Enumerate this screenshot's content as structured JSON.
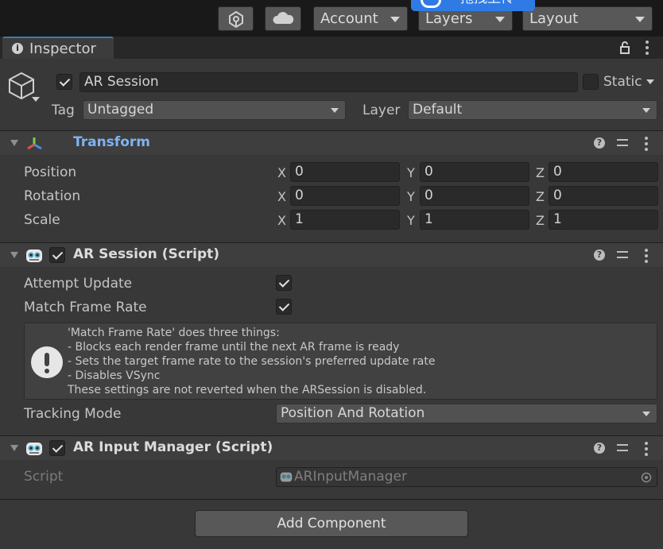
{
  "toolbar": {
    "account_label": "Account",
    "layers_label": "Layers",
    "layout_label": "Layout",
    "overlay_text": "拖拽上传"
  },
  "tab": {
    "label": "Inspector"
  },
  "gameobject": {
    "active": true,
    "name": "AR Session",
    "static_label": "Static",
    "tag_label": "Tag",
    "tag_value": "Untagged",
    "layer_label": "Layer",
    "layer_value": "Default"
  },
  "transform": {
    "title": "Transform",
    "rows": [
      {
        "label": "Position",
        "x": "0",
        "y": "0",
        "z": "0"
      },
      {
        "label": "Rotation",
        "x": "0",
        "y": "0",
        "z": "0"
      },
      {
        "label": "Scale",
        "x": "1",
        "y": "1",
        "z": "1"
      }
    ],
    "axis_labels": {
      "x": "X",
      "y": "Y",
      "z": "Z"
    }
  },
  "ar_session": {
    "title": "AR Session (Script)",
    "enabled": true,
    "attempt_update_label": "Attempt Update",
    "attempt_update": true,
    "match_frame_rate_label": "Match Frame Rate",
    "match_frame_rate": true,
    "help_lines": [
      "'Match Frame Rate' does three things:",
      "- Blocks each render frame until the next AR frame is ready",
      "- Sets the target frame rate to the session's preferred update rate",
      "- Disables VSync",
      "These settings are not reverted when the ARSession is disabled."
    ],
    "tracking_mode_label": "Tracking Mode",
    "tracking_mode_value": "Position And Rotation"
  },
  "ar_input_manager": {
    "title": "AR Input Manager (Script)",
    "enabled": true,
    "script_label": "Script",
    "script_value": "ARInputManager"
  },
  "add_component_label": "Add Component",
  "colors": {
    "background": "#383838",
    "toolbar": "#191919",
    "transform_title": "#7fb2f0",
    "tab_accent": "#3a79bb"
  }
}
